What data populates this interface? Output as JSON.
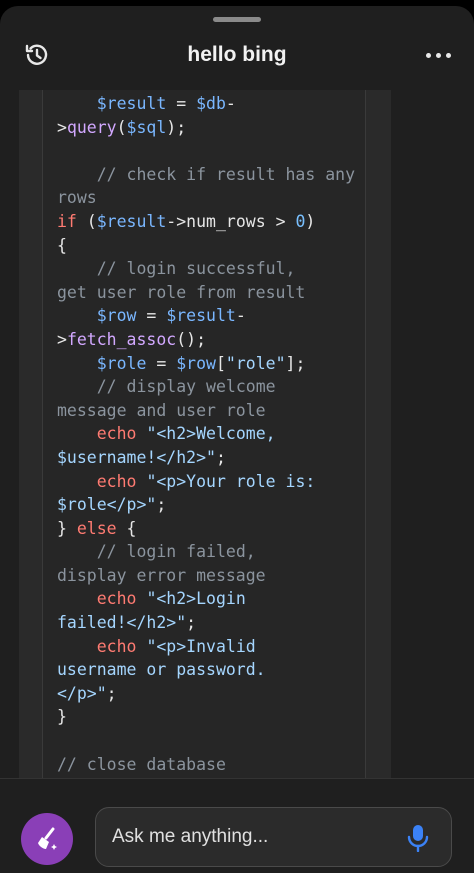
{
  "header": {
    "title": "hello bing",
    "left_icon": "history-icon",
    "right_icon": "more-icon"
  },
  "code": {
    "lines": [
      [
        [
          "plain",
          "    "
        ],
        [
          "var",
          "$result"
        ],
        [
          "plain",
          " = "
        ],
        [
          "var",
          "$db"
        ],
        [
          "plain",
          "-"
        ]
      ],
      [
        [
          "plain",
          ">"
        ],
        [
          "fn",
          "query"
        ],
        [
          "plain",
          "("
        ],
        [
          "var",
          "$sql"
        ],
        [
          "plain",
          ");"
        ]
      ],
      [
        [
          "plain",
          ""
        ]
      ],
      [
        [
          "plain",
          "    "
        ],
        [
          "com",
          "// check if result has any"
        ]
      ],
      [
        [
          "com",
          "rows"
        ]
      ],
      [
        [
          "kw",
          "if"
        ],
        [
          "plain",
          " ("
        ],
        [
          "var",
          "$result"
        ],
        [
          "plain",
          "->num_rows > "
        ],
        [
          "num",
          "0"
        ],
        [
          "plain",
          ")"
        ]
      ],
      [
        [
          "plain",
          "{"
        ]
      ],
      [
        [
          "plain",
          "    "
        ],
        [
          "com",
          "// login successful,"
        ]
      ],
      [
        [
          "com",
          "get user role from result"
        ]
      ],
      [
        [
          "plain",
          "    "
        ],
        [
          "var",
          "$row"
        ],
        [
          "plain",
          " = "
        ],
        [
          "var",
          "$result"
        ],
        [
          "plain",
          "-"
        ]
      ],
      [
        [
          "plain",
          ">"
        ],
        [
          "fn",
          "fetch_assoc"
        ],
        [
          "plain",
          "();"
        ]
      ],
      [
        [
          "plain",
          "    "
        ],
        [
          "var",
          "$role"
        ],
        [
          "plain",
          " = "
        ],
        [
          "var",
          "$row"
        ],
        [
          "plain",
          "["
        ],
        [
          "str",
          "\"role\""
        ],
        [
          "plain",
          "];"
        ]
      ],
      [
        [
          "plain",
          "    "
        ],
        [
          "com",
          "// display welcome"
        ]
      ],
      [
        [
          "com",
          "message and user role"
        ]
      ],
      [
        [
          "plain",
          "    "
        ],
        [
          "kw",
          "echo"
        ],
        [
          "plain",
          " "
        ],
        [
          "str",
          "\"<h2>Welcome,"
        ]
      ],
      [
        [
          "str",
          "$username!</h2>\""
        ],
        [
          "plain",
          ";"
        ]
      ],
      [
        [
          "plain",
          "    "
        ],
        [
          "kw",
          "echo"
        ],
        [
          "plain",
          " "
        ],
        [
          "str",
          "\"<p>Your role is:"
        ]
      ],
      [
        [
          "str",
          "$role</p>\""
        ],
        [
          "plain",
          ";"
        ]
      ],
      [
        [
          "plain",
          "} "
        ],
        [
          "kw",
          "else"
        ],
        [
          "plain",
          " {"
        ]
      ],
      [
        [
          "plain",
          "    "
        ],
        [
          "com",
          "// login failed,"
        ]
      ],
      [
        [
          "com",
          "display error message"
        ]
      ],
      [
        [
          "plain",
          "    "
        ],
        [
          "kw",
          "echo"
        ],
        [
          "plain",
          " "
        ],
        [
          "str",
          "\"<h2>Login"
        ]
      ],
      [
        [
          "str",
          "failed!</h2>\""
        ],
        [
          "plain",
          ";"
        ]
      ],
      [
        [
          "plain",
          "    "
        ],
        [
          "kw",
          "echo"
        ],
        [
          "plain",
          " "
        ],
        [
          "str",
          "\"<p>Invalid"
        ]
      ],
      [
        [
          "str",
          "username or password."
        ]
      ],
      [
        [
          "str",
          "</p>\""
        ],
        [
          "plain",
          ";"
        ]
      ],
      [
        [
          "plain",
          "}"
        ]
      ],
      [
        [
          "plain",
          ""
        ]
      ],
      [
        [
          "com",
          "// close database"
        ]
      ]
    ]
  },
  "input": {
    "placeholder": "Ask me anything..."
  },
  "colors": {
    "background": "#1f1f1f",
    "new_topic_button": "#8a3fb7",
    "mic_icon": "#3b82f6"
  }
}
